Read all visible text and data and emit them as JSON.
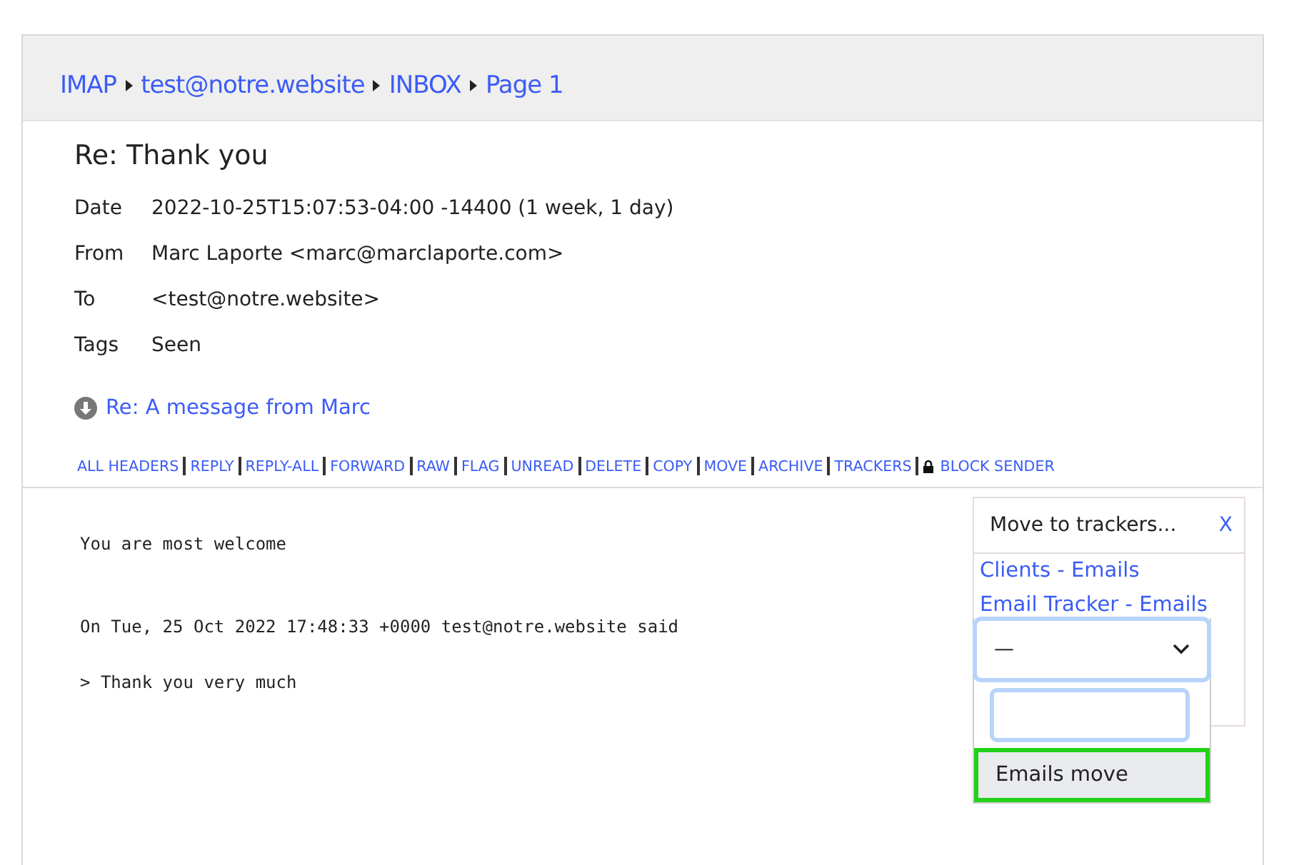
{
  "breadcrumb": [
    "IMAP",
    "test@notre.website",
    "INBOX",
    "Page 1"
  ],
  "message": {
    "subject": "Re: Thank you",
    "headers": [
      {
        "label": "Date",
        "value": "2022-10-25T15:07:53-04:00 -14400 (1 week, 1 day)"
      },
      {
        "label": "From",
        "value": "Marc Laporte <marc@marclaporte.com>"
      },
      {
        "label": "To",
        "value": "<test@notre.website>"
      },
      {
        "label": "Tags",
        "value": "Seen"
      }
    ],
    "related_link": "Re: A message from Marc",
    "actions": [
      {
        "label": "ALL HEADERS",
        "kind": "plain"
      },
      {
        "label": "REPLY",
        "kind": "plain"
      },
      {
        "label": "REPLY-ALL",
        "kind": "plain"
      },
      {
        "label": "FORWARD",
        "kind": "plain"
      },
      {
        "label": "RAW",
        "kind": "plain"
      },
      {
        "label": "FLAG",
        "kind": "plain"
      },
      {
        "label": "UNREAD",
        "kind": "plain"
      },
      {
        "label": "DELETE",
        "kind": "plain"
      },
      {
        "label": "COPY",
        "kind": "plain"
      },
      {
        "label": "MOVE",
        "kind": "plain"
      },
      {
        "label": "ARCHIVE",
        "kind": "plain"
      },
      {
        "label": "TRACKERS",
        "kind": "plain"
      },
      {
        "label": "BLOCK SENDER",
        "kind": "locked"
      }
    ],
    "body": [
      "You are most welcome",
      "On Tue, 25 Oct 2022 17:48:33 +0000 test@notre.website said",
      "> Thank you very much"
    ]
  },
  "move_panel": {
    "title": "Move to trackers...",
    "close": "X",
    "trackers": [
      "Clients - Emails",
      "Email Tracker - Emails"
    ],
    "dropdown": {
      "value": "—",
      "options": [
        {
          "label": "Emails move",
          "selected": true
        }
      ]
    }
  }
}
